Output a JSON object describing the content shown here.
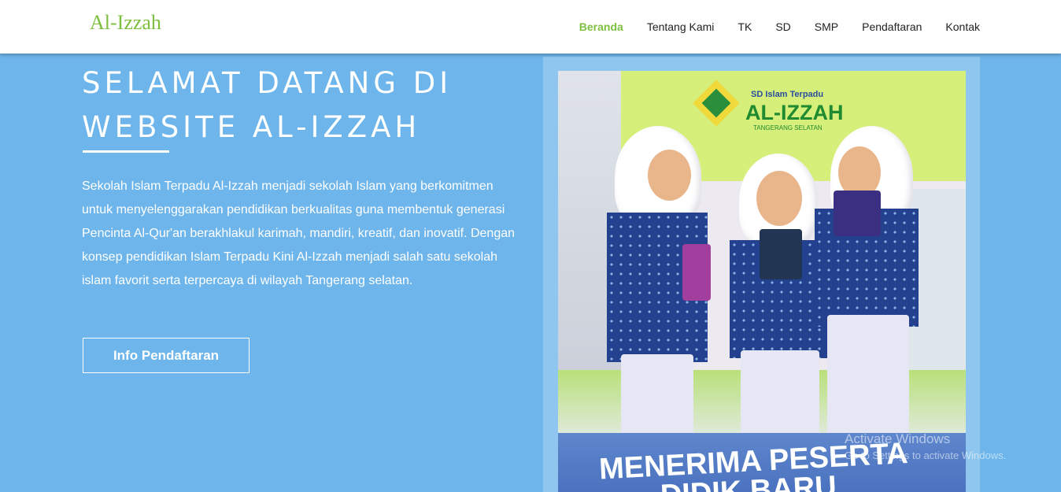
{
  "header": {
    "brand": "Al-Izzah",
    "nav": [
      "Beranda",
      "Tentang Kami",
      "TK",
      "SD",
      "SMP",
      "Pendaftaran",
      "Kontak"
    ],
    "active_nav": "Beranda",
    "accent_color": "#7dbf3e"
  },
  "hero": {
    "title_line1": "SELAMAT DATANG DI",
    "title_line2": "WEBSITE AL-IZZAH",
    "paragraph": "Sekolah Islam Terpadu Al-Izzah menjadi sekolah Islam yang berkomitmen untuk menyelenggarakan pendidikan berkualitas guna membentuk generasi Pencinta Al-Qur'an berakhlakul karimah, mandiri, kreatif, dan inovatif. Dengan konsep pendidikan Islam Terpadu Kini Al-Izzah menjadi salah satu sekolah islam favorit serta terpercaya di wilayah Tangerang selatan.",
    "button_label": "Info Pendaftaran",
    "background_color": "#6db5ea"
  },
  "poster": {
    "logo_subtitle": "SD Islam Terpadu",
    "logo_title": "AL-IZZAH",
    "logo_city": "TANGERANG SELATAN",
    "banner_line1": "MENERIMA PESERTA",
    "banner_line2": "DIDIK BARU"
  },
  "watermark": {
    "line1": "Activate Windows",
    "line2": "Go to Settings to activate Windows."
  }
}
